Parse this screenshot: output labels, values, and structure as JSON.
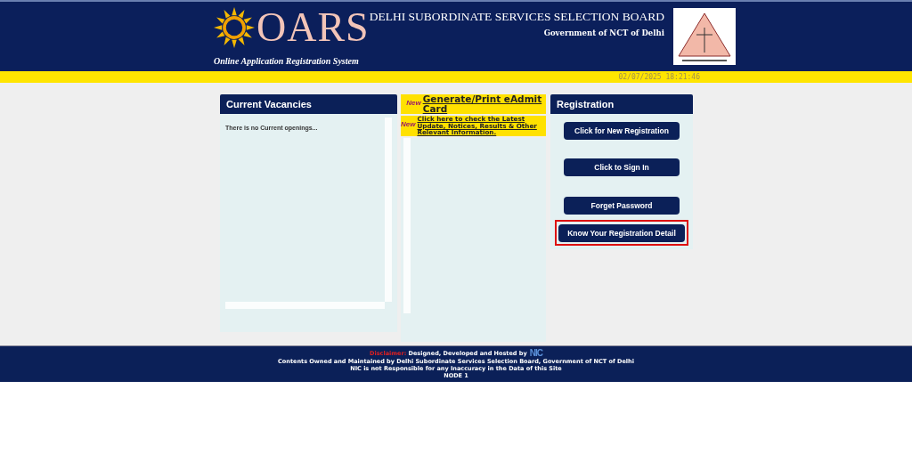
{
  "header": {
    "logo": "OARS",
    "logo_caption": "Online Application Registration System",
    "board": "DELHI SUBORDINATE SERVICES SELECTION BOARD",
    "government": "Government of NCT of Delhi"
  },
  "datetime": "02/07/2025 18:21:46",
  "vacancies": {
    "title": "Current Vacancies",
    "message": "There is no Current openings..."
  },
  "notices": [
    {
      "badge": "New",
      "text": "Generate/Print eAdmit Card",
      "kind": "large"
    },
    {
      "badge": "New",
      "text": "Click here to check the Latest Update, Notices, Results & Other Relevant Information.",
      "kind": "small"
    }
  ],
  "registration": {
    "title": "Registration",
    "buttons": [
      {
        "label": "Click for New Registration",
        "highlighted": false
      },
      {
        "label": "Click to Sign In",
        "highlighted": false
      },
      {
        "label": "Forget Password",
        "highlighted": false
      },
      {
        "label": "Know Your Registration Detail",
        "highlighted": true
      }
    ]
  },
  "footer": {
    "disclaimer_label": "Disclaimer:",
    "disclaimer": "Designed, Developed and Hosted by",
    "nic": "NIC",
    "lines": [
      "Contents Owned and Maintained by Delhi Subordinate Services Selection Board, Government of NCT of Delhi",
      "NIC is not Responsible for any Inaccuracy in the Data of this Site",
      "NODE 1"
    ]
  }
}
